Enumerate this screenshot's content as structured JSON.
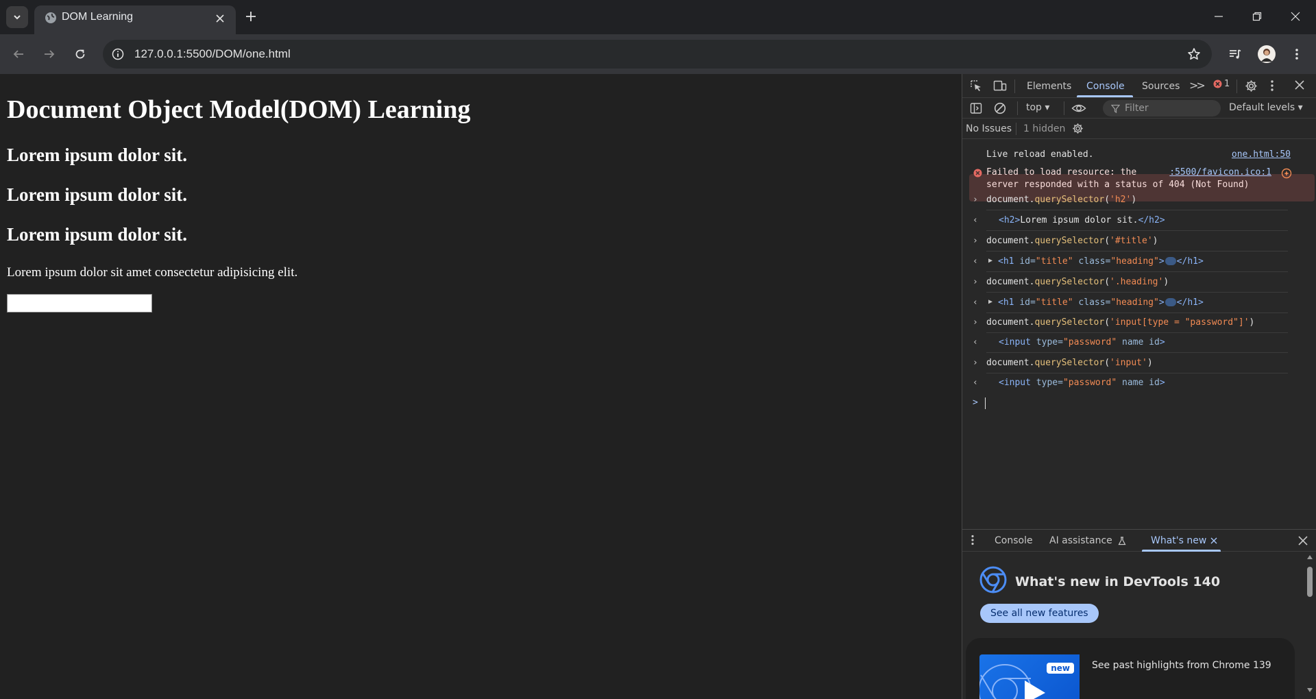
{
  "browser": {
    "tab_title": "DOM Learning",
    "url": "127.0.0.1:5500/DOM/one.html"
  },
  "page": {
    "h1": "Document Object Model(DOM) Learning",
    "h2_items": [
      "Lorem ipsum dolor sit.",
      "Lorem ipsum dolor sit.",
      "Lorem ipsum dolor sit."
    ],
    "paragraph": "Lorem ipsum dolor sit amet consectetur adipisicing elit."
  },
  "devtools": {
    "tabs": [
      "Elements",
      "Console",
      "Sources"
    ],
    "more_tabs": ">>",
    "error_count": "1",
    "context": "top ▾",
    "filter_placeholder": "Filter",
    "levels": "Default levels ▾",
    "issues": {
      "label": "No Issues",
      "hidden": "1 hidden"
    },
    "messages": {
      "live_reload": "Live reload enabled.",
      "live_reload_link": "one.html:50",
      "error_line1": "Failed to load resource: the",
      "error_line2": "server responded with a status of 404 (Not Found)",
      "error_link": ":5500/favicon.ico:1"
    },
    "commands": [
      {
        "obj": "document.",
        "fn": "querySelector",
        "open": "(",
        "arg": "'h2'",
        "close": ")"
      },
      {
        "obj": "document.",
        "fn": "querySelector",
        "open": "(",
        "arg": "'#title'",
        "close": ")"
      },
      {
        "obj": "document.",
        "fn": "querySelector",
        "open": "(",
        "arg": "'.heading'",
        "close": ")"
      },
      {
        "obj": "document.",
        "fn": "querySelector",
        "open": "(",
        "arg": "'input[type = \"password\"]'",
        "close": ")"
      },
      {
        "obj": "document.",
        "fn": "querySelector",
        "open": "(",
        "arg": "'input'",
        "close": ")"
      }
    ],
    "results": {
      "h2_open": "<h2>",
      "h2_text": "Lorem ipsum dolor sit.",
      "h2_close": "</h2>",
      "h1_open": "<h1",
      "attr_id": "id=",
      "val_title": "\"title\"",
      "attr_class": "class=",
      "val_heading": "\"heading\"",
      "gt": ">",
      "h1_close": "</h1>",
      "input_open": "<input",
      "attr_type": "type=",
      "val_password": "\"password\"",
      "attr_name_id": "name id",
      "input_close": ">"
    },
    "prompt_chevron": ">",
    "drawer": {
      "tabs": [
        "Console",
        "AI assistance",
        "What's new"
      ],
      "whatsnew_title": "What's new in DevTools 140",
      "see_all": "See all new features",
      "new_badge": "new",
      "highlights": "See past highlights from Chrome 139"
    }
  },
  "colors": {
    "accent": "#a8c7fa",
    "error": "#e46962",
    "page_bg": "#212121"
  }
}
